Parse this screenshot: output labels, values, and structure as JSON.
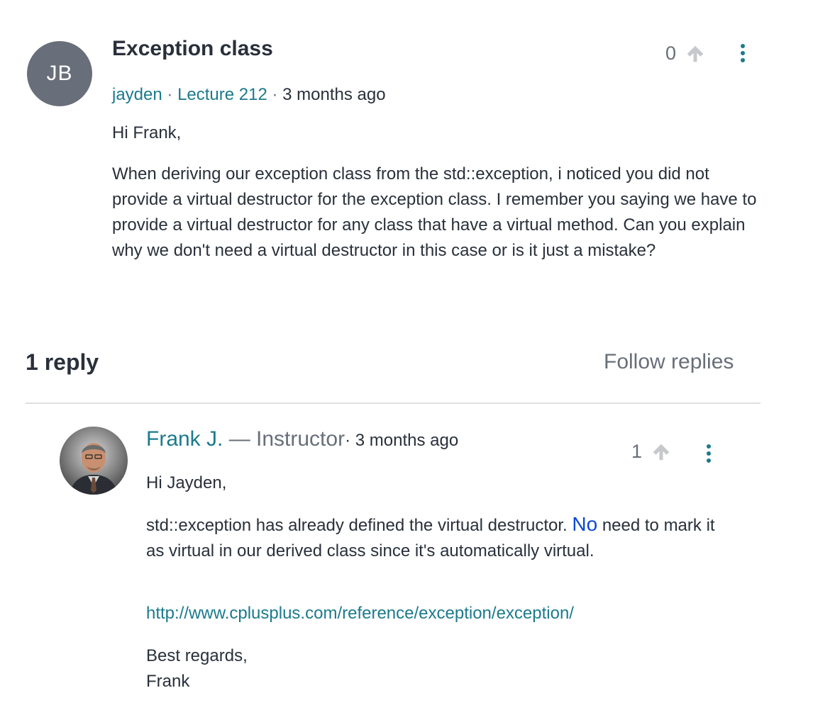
{
  "question": {
    "avatar_initials": "JB",
    "title": "Exception class",
    "author": "jayden",
    "separator": " · ",
    "lecture": "Lecture 212",
    "time": "3 months ago",
    "greeting": "Hi Frank,",
    "body": "When deriving our exception class from the std::exception, i noticed you did not provide a virtual destructor for the exception class. I remember you saying we have to provide a virtual destructor for any class that have a virtual method. Can you explain why we don't need a virtual destructor in this case or is it just a mistake?",
    "votes": "0",
    "upvote_icon": "arrow-up-icon",
    "menu_icon": "kebab-menu-icon"
  },
  "replies_header": {
    "count_label": "1 reply",
    "follow_label": "Follow replies"
  },
  "reply": {
    "author": "Frank J.",
    "role": " — Instructor",
    "time": "· 3 months ago",
    "greeting": "Hi Jayden,",
    "body_start": "std::exception has already defined the virtual destructor. ",
    "body_highlight": "No",
    "body_end": " need to mark it as virtual in our derived class since it's automatically virtual.",
    "link": "http://www.cplusplus.com/reference/exception/exception/",
    "sign_line1": "Best regards,",
    "sign_line2": "Frank",
    "votes": "1",
    "upvote_icon": "arrow-up-icon",
    "menu_icon": "kebab-menu-icon"
  },
  "colors": {
    "link": "#1c7a8c",
    "text": "#29303b",
    "muted": "#686f7a",
    "avatar_bg": "#686f7a",
    "highlight": "#0d47d9"
  }
}
